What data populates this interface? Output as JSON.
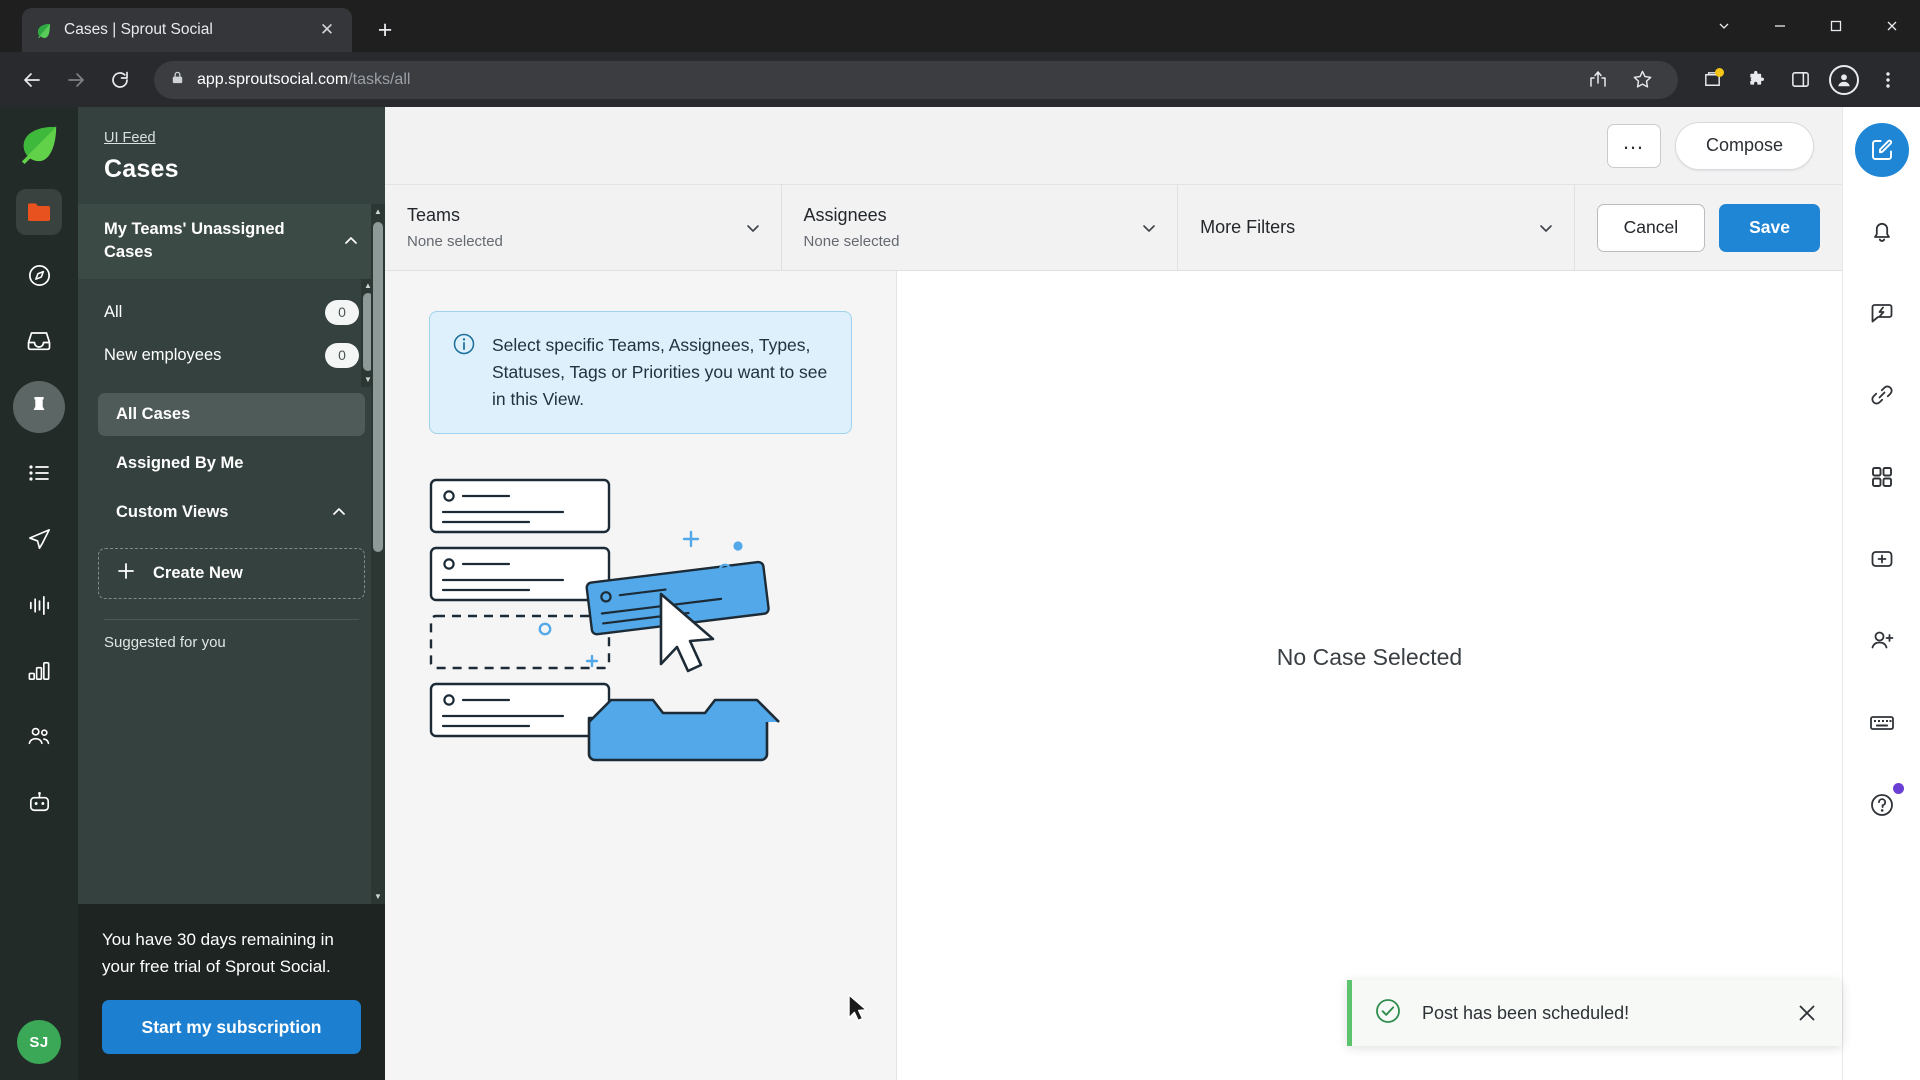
{
  "browser": {
    "tab": {
      "title": "Cases | Sprout Social",
      "favicon": "sprout-leaf-icon",
      "close_label": "✕"
    },
    "new_tab_label": "+",
    "window_controls": {
      "minimize": "⌄",
      "shrink": "─",
      "maximize": "□",
      "close": "✕"
    },
    "url": {
      "domain": "app.sproutsocial.com",
      "path": "/tasks/all",
      "lock": "lock-icon"
    },
    "toolbar_icons": [
      "back-arrow",
      "forward-arrow",
      "reload",
      "share",
      "bookmark-star",
      "extensions-puzzle",
      "side-panel",
      "profile",
      "chrome-menu"
    ]
  },
  "rail": {
    "logo": "sprout-leaf-logo",
    "items": [
      {
        "name": "folder",
        "icon": "folder-icon"
      },
      {
        "name": "compass",
        "icon": "compass-icon"
      },
      {
        "name": "inbox",
        "icon": "inbox-icon"
      },
      {
        "name": "pinned",
        "icon": "pin-icon",
        "active": true
      },
      {
        "name": "list",
        "icon": "list-icon"
      },
      {
        "name": "publishing",
        "icon": "paper-plane-icon"
      },
      {
        "name": "listening",
        "icon": "waveform-icon"
      },
      {
        "name": "reports",
        "icon": "bar-chart-icon"
      },
      {
        "name": "contacts",
        "icon": "people-icon"
      },
      {
        "name": "bot",
        "icon": "chatbot-icon"
      }
    ],
    "avatar_initials": "SJ"
  },
  "nav": {
    "breadcrumb": "UI Feed",
    "title": "Cases",
    "section": {
      "label": "My Teams' Unassigned Cases",
      "expanded": true,
      "chevron": "chevron-up-icon"
    },
    "sub_items": [
      {
        "label": "All",
        "count": "0"
      },
      {
        "label": "New employees",
        "count": "0"
      }
    ],
    "views": [
      {
        "label": "All Cases",
        "selected": true
      },
      {
        "label": "Assigned By Me",
        "selected": false
      }
    ],
    "custom_views": {
      "label": "Custom Views",
      "chevron": "chevron-up-icon"
    },
    "create_new": {
      "label": "Create New",
      "icon": "plus-icon"
    },
    "suggested_label": "Suggested for you",
    "trial": {
      "message": "You have 30 days remaining in your free trial of Sprout Social.",
      "cta": "Start my subscription"
    }
  },
  "main": {
    "more_button": "…",
    "compose_button": "Compose",
    "filters": [
      {
        "label": "Teams",
        "value": "None selected",
        "chevron": "chevron-down-icon"
      },
      {
        "label": "Assignees",
        "value": "None selected",
        "chevron": "chevron-down-icon"
      },
      {
        "label": "More Filters",
        "value": "",
        "chevron": "chevron-down-icon"
      }
    ],
    "cancel_button": "Cancel",
    "save_button": "Save",
    "info_banner": {
      "icon": "info-circle-icon",
      "text": "Select specific Teams, Assignees, Types, Statuses, Tags or Priorities you want to see in this View."
    },
    "illustration": "empty-cases-illustration",
    "empty_state": "No Case Selected"
  },
  "icon_rail": [
    {
      "name": "compose",
      "icon": "compose-pencil-icon",
      "primary": true
    },
    {
      "name": "notifications",
      "icon": "bell-icon"
    },
    {
      "name": "quick-actions",
      "icon": "lightning-message-icon"
    },
    {
      "name": "links",
      "icon": "link-icon"
    },
    {
      "name": "apps",
      "icon": "grid-icon"
    },
    {
      "name": "add-widget",
      "icon": "plus-box-icon"
    },
    {
      "name": "invite-user",
      "icon": "person-add-icon"
    },
    {
      "name": "shortcuts",
      "icon": "keyboard-icon"
    },
    {
      "name": "help",
      "icon": "question-circle-icon",
      "badge": true
    }
  ],
  "toast": {
    "icon": "check-circle-icon",
    "message": "Post has been scheduled!",
    "close": "✕",
    "accent_color": "#5cc46c"
  },
  "colors": {
    "rail_bg": "#232b29",
    "nav_bg": "#34413e",
    "accent_blue": "#1f86d6",
    "info_bg": "#ddf0fb",
    "toast_green": "#5cc46c",
    "sprout_green": "#3aa856"
  }
}
